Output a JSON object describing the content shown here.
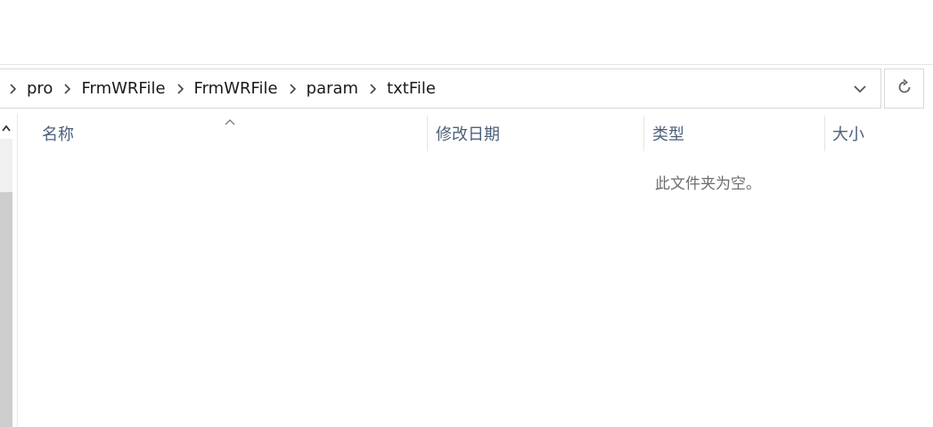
{
  "address_bar": {
    "breadcrumbs": [
      {
        "label": "pro"
      },
      {
        "label": "FrmWRFile"
      },
      {
        "label": "FrmWRFile"
      },
      {
        "label": "param"
      },
      {
        "label": "txtFile"
      }
    ]
  },
  "icons": {
    "crumb_separator": "chevron-right-icon",
    "address_dropdown": "chevron-down-icon",
    "refresh": "refresh-icon",
    "scroll_up": "chevron-up-icon",
    "sort_indicator": "sort-ascending-icon"
  },
  "columns": {
    "name": "名称",
    "date_modified": "修改日期",
    "type": "类型",
    "size": "大小"
  },
  "empty_message": "此文件夹为空。",
  "colors": {
    "header_text": "#4c607a",
    "empty_text": "#6d6d6d",
    "border": "#d9d9d9",
    "scroll_thumb": "#cdcdcd"
  }
}
